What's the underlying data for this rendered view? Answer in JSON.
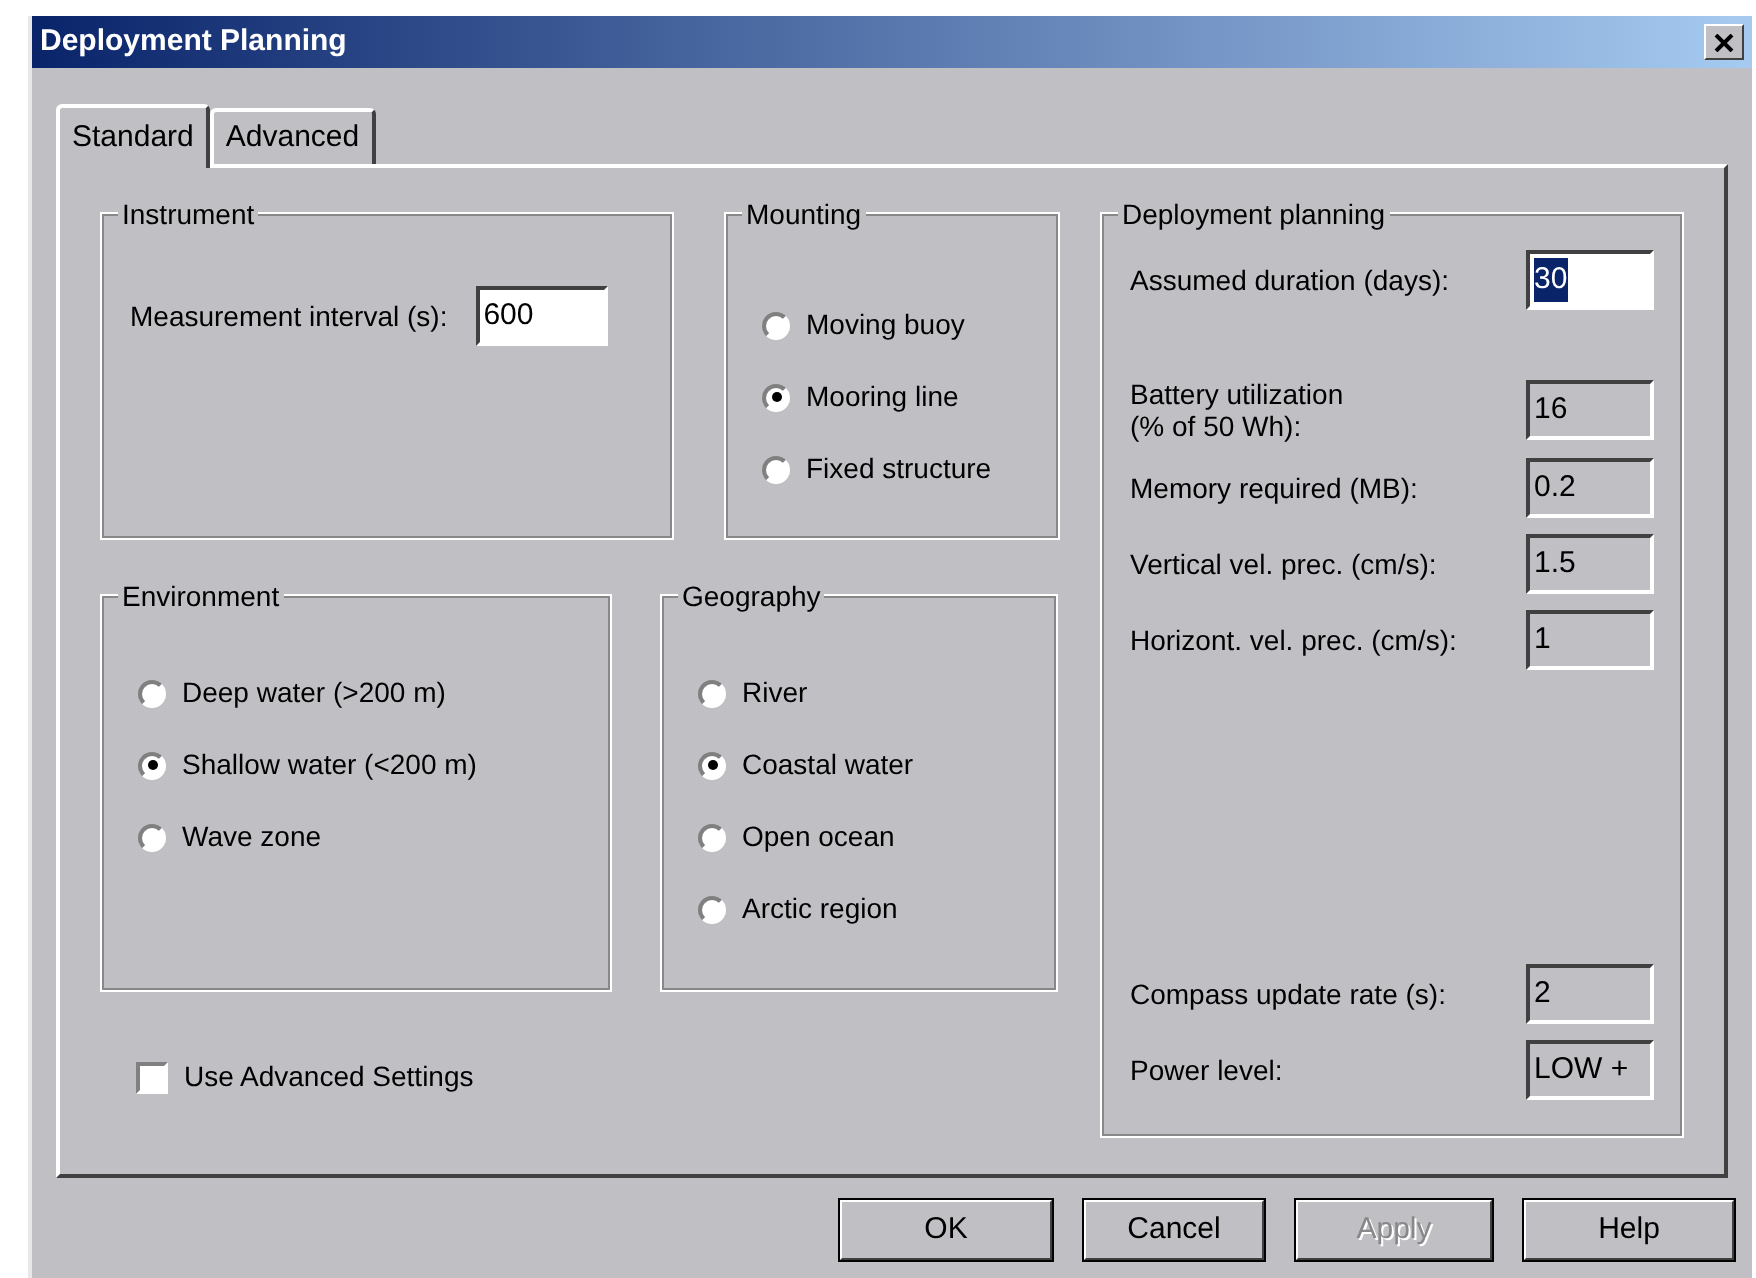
{
  "window": {
    "title": "Deployment Planning"
  },
  "tabs": [
    {
      "label": "Standard",
      "selected": true
    },
    {
      "label": "Advanced",
      "selected": false
    }
  ],
  "instrument": {
    "title": "Instrument",
    "field": {
      "label": "Measurement interval (s):",
      "value": "600"
    }
  },
  "mounting": {
    "title": "Mounting",
    "options": [
      {
        "label": "Moving buoy",
        "selected": false
      },
      {
        "label": "Mooring line",
        "selected": true
      },
      {
        "label": "Fixed structure",
        "selected": false
      }
    ]
  },
  "environment": {
    "title": "Environment",
    "options": [
      {
        "label": "Deep water (>200 m)",
        "selected": false
      },
      {
        "label": "Shallow water (<200 m)",
        "selected": true
      },
      {
        "label": "Wave zone",
        "selected": false
      }
    ]
  },
  "geography": {
    "title": "Geography",
    "options": [
      {
        "label": "River",
        "selected": false
      },
      {
        "label": "Coastal water",
        "selected": true
      },
      {
        "label": "Open ocean",
        "selected": false
      },
      {
        "label": "Arctic region",
        "selected": false
      }
    ]
  },
  "advanced_settings": {
    "label": "Use Advanced Settings",
    "checked": false
  },
  "deployment_planning": {
    "title": "Deployment planning",
    "groups": [
      [
        {
          "label": "Assumed duration (days):",
          "value": "30",
          "kind": "editable",
          "text_selected": true
        }
      ],
      [
        {
          "label": "Battery utilization\n(% of 50 Wh):",
          "value": "16",
          "kind": "readonly",
          "text_selected": false
        },
        {
          "label": "Memory required (MB):",
          "value": "0.2",
          "kind": "readonly",
          "text_selected": false
        },
        {
          "label": "Vertical vel. prec. (cm/s):",
          "value": "1.5",
          "kind": "readonly",
          "text_selected": false
        },
        {
          "label": "Horizont. vel. prec. (cm/s):",
          "value": "1",
          "kind": "readonly",
          "text_selected": false
        }
      ],
      [
        {
          "label": "Compass update rate (s):",
          "value": "2",
          "kind": "readonly",
          "text_selected": false
        },
        {
          "label": "Power level:",
          "value": "LOW +",
          "kind": "readonly",
          "text_selected": false
        }
      ]
    ]
  },
  "buttons": [
    {
      "label": "OK",
      "disabled": false
    },
    {
      "label": "Cancel",
      "disabled": false
    },
    {
      "label": "Apply",
      "disabled": true
    },
    {
      "label": "Help",
      "disabled": false
    }
  ]
}
